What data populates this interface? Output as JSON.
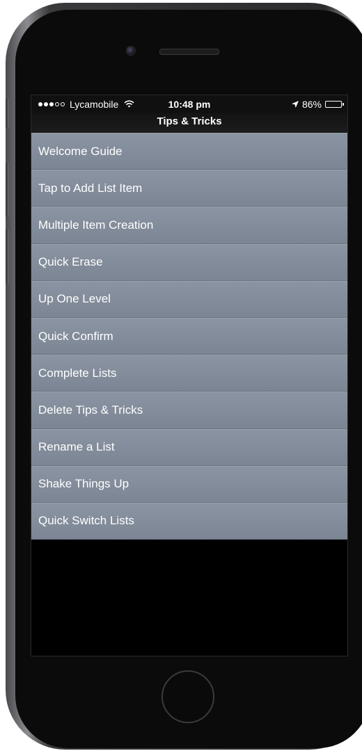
{
  "status_bar": {
    "signal": [
      true,
      true,
      true,
      false,
      false
    ],
    "carrier": "Lycamobile",
    "time": "10:48 pm",
    "battery_text": "86%",
    "battery_level": 0.86
  },
  "nav": {
    "title": "Tips & Tricks"
  },
  "items": [
    {
      "label": "Welcome Guide"
    },
    {
      "label": "Tap to Add List Item"
    },
    {
      "label": "Multiple Item Creation"
    },
    {
      "label": "Quick Erase"
    },
    {
      "label": "Up One Level"
    },
    {
      "label": "Quick Confirm"
    },
    {
      "label": "Complete Lists"
    },
    {
      "label": "Delete Tips & Tricks"
    },
    {
      "label": "Rename a List"
    },
    {
      "label": "Shake Things Up"
    },
    {
      "label": "Quick Switch Lists"
    }
  ],
  "colors": {
    "row_background": "#838c99",
    "row_text": "#ffffff",
    "screen_background": "#000000"
  }
}
